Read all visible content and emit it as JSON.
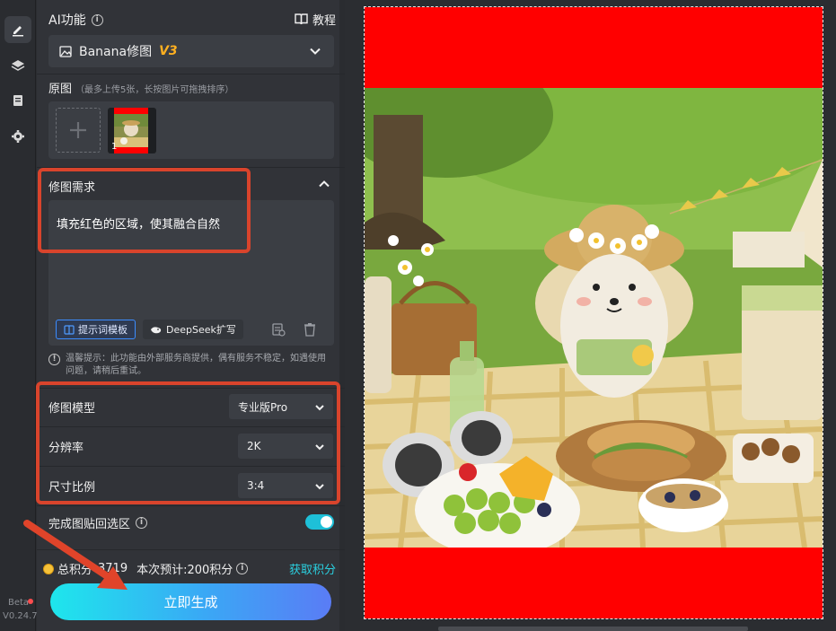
{
  "header": {
    "title": "AI功能",
    "tutorial": "教程"
  },
  "model_select": {
    "name": "Banana修图",
    "version": "V3"
  },
  "original": {
    "label": "原图",
    "hint": "（最多上传5张，长按图片可拖拽排序）",
    "image_index": "1"
  },
  "requirement": {
    "label": "修图需求",
    "text": "填充红色的区域，使其融合自然",
    "template_button": "提示词模板",
    "deepseek_button": "DeepSeek扩写"
  },
  "notice": "温馨提示：此功能由外部服务商提供，偶有服务不稳定，如遇使用问题，请稍后重试。",
  "params": [
    {
      "label": "修图模型",
      "value": "专业版Pro"
    },
    {
      "label": "分辨率",
      "value": "2K"
    },
    {
      "label": "尺寸比例",
      "value": "3:4"
    }
  ],
  "toggle": {
    "label": "完成图贴回选区",
    "on": true
  },
  "points": {
    "total_label": "总积分",
    "total_value": "3719",
    "estimate": "本次预计:200积分",
    "get_points": "获取积分"
  },
  "generate_button": "立即生成",
  "footer": {
    "beta": "Beta",
    "version": "V0.24.7"
  },
  "colors": {
    "accent": "#1ec0d8",
    "highlight": "#d9442c",
    "fill_red": "#ff0000"
  }
}
